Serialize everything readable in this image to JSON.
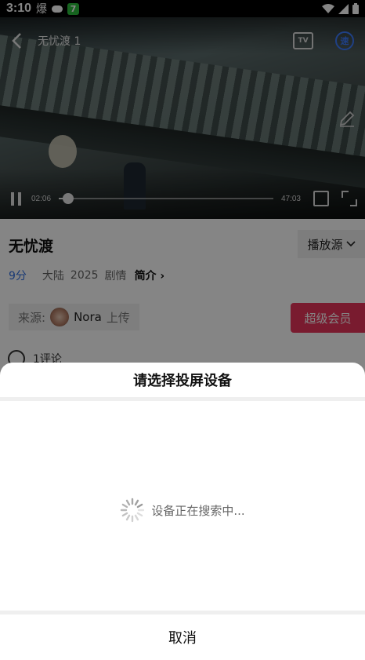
{
  "status_bar": {
    "time": "3:10",
    "weather_char": "爆"
  },
  "video": {
    "title": "无忧渡 1",
    "tv_label": "TV",
    "speed_label": "速",
    "current_time": "02:06",
    "total_time": "47:03",
    "progress_fraction": 0.044
  },
  "info": {
    "title": "无忧渡",
    "source_label": "播放源",
    "score": "9分",
    "region": "大陆",
    "year": "2025",
    "genre": "剧情",
    "intro_label": "简介",
    "source_prefix": "来源:",
    "uploader": "Nora",
    "upload_suffix": "上传",
    "vip_label": "超级会员",
    "comment_count": "1评论"
  },
  "sheet": {
    "title": "请选择投屏设备",
    "searching_text": "设备正在搜索中...",
    "cancel_label": "取消"
  },
  "colors": {
    "accent_blue": "#2f6de1",
    "vip_pink": "#e8345a"
  }
}
